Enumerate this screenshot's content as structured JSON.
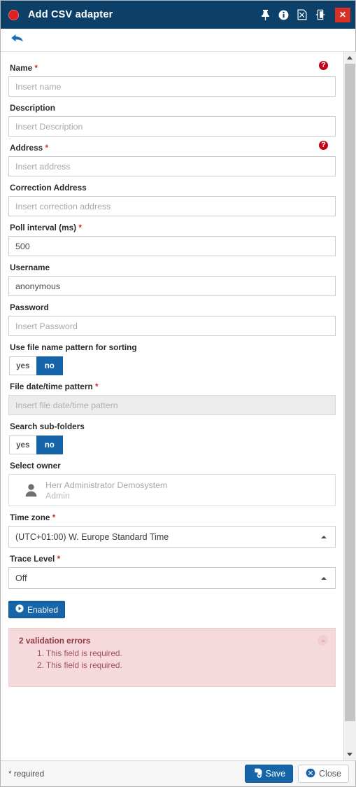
{
  "titlebar": {
    "title": "Add CSV adapter",
    "record_dot": "record-indicator",
    "icons": [
      "pin-icon",
      "info-icon",
      "pdf-export-icon",
      "detach-window-icon"
    ],
    "close_label": "✕",
    "bg_color": "#0d4068",
    "close_color": "#d93025"
  },
  "toolbar": {
    "back_label": "back-arrow-icon"
  },
  "form": {
    "name": {
      "label": "Name",
      "required": "*",
      "placeholder": "Insert name",
      "value": "",
      "error": "?"
    },
    "description": {
      "label": "Description",
      "placeholder": "Insert Description",
      "value": ""
    },
    "address": {
      "label": "Address",
      "required": "*",
      "placeholder": "Insert address",
      "value": "",
      "error": "?"
    },
    "correction_address": {
      "label": "Correction Address",
      "placeholder": "Insert correction address",
      "value": ""
    },
    "poll_interval": {
      "label": "Poll interval (ms)",
      "required": "*",
      "value": "500"
    },
    "username": {
      "label": "Username",
      "value": "anonymous"
    },
    "password": {
      "label": "Password",
      "placeholder": "Insert Password",
      "value": ""
    },
    "use_file_name_pattern": {
      "label": "Use file name pattern for sorting",
      "yes_label": "yes",
      "no_label": "no",
      "selected": "no"
    },
    "file_datetime_pattern": {
      "label": "File date/time pattern",
      "required": "*",
      "placeholder": "Insert file date/time pattern",
      "value": "",
      "disabled": true
    },
    "search_subfolders": {
      "label": "Search sub-folders",
      "yes_label": "yes",
      "no_label": "no",
      "selected": "no"
    },
    "select_owner": {
      "label": "Select owner",
      "owner_name": "Herr Administrator Demosystem",
      "owner_role": "Admin",
      "avatar": "person-icon"
    },
    "time_zone": {
      "label": "Time zone",
      "required": "*",
      "value": "(UTC+01:00) W. Europe Standard Time"
    },
    "trace_level": {
      "label": "Trace Level",
      "required": "*",
      "value": "Off"
    },
    "enabled_button": {
      "label": "Enabled",
      "icon": "play-circle-icon",
      "color": "#1565a8"
    }
  },
  "validation": {
    "title": "2 validation errors",
    "errors": [
      "1. This field is required.",
      "2. This field is required."
    ],
    "collapse_icon": "chevron-up-icon",
    "bg_color": "#f6d9dc",
    "text_color": "#a2525a"
  },
  "footer": {
    "required_note": "* required",
    "save_label": "Save",
    "save_icon": "save-disk-icon",
    "close_label": "Close",
    "close_icon": "cancel-circle-icon"
  },
  "scrollbar": {
    "up_icon": "scroll-up-arrow",
    "down_icon": "scroll-down-arrow"
  }
}
